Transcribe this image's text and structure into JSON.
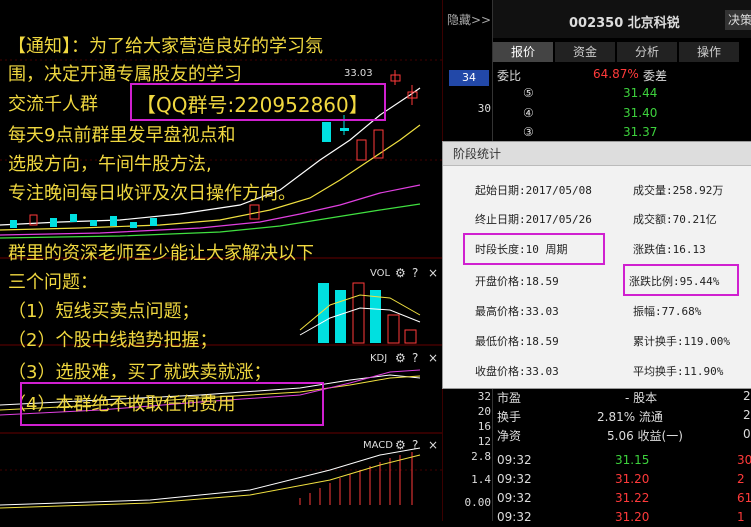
{
  "app": {
    "hide_label": "隐藏>>",
    "stock_title": "002350 北京科锐",
    "decision_button": "决策"
  },
  "tabs": [
    "报价",
    "资金",
    "分析",
    "操作"
  ],
  "quote": {
    "weibi_label": "委比",
    "weibi_value": "64.87%",
    "weicha_label": "委差",
    "sell_rows": [
      {
        "level": "⑤",
        "price": "31.44"
      },
      {
        "level": "④",
        "price": "31.40"
      },
      {
        "level": "③",
        "price": "31.37"
      }
    ]
  },
  "axis_labels": {
    "price_hl": "34",
    "price_30": "30",
    "p2_8": "2.8",
    "p1_4": "1.4",
    "p0_00": "0.00",
    "m32": "32",
    "m20": "20",
    "m16": "16",
    "m12": "12"
  },
  "chart_labels": {
    "date_tag": "33.03",
    "vol": "VOL",
    "kdj": "KDJ",
    "macd": "MACD",
    "gear": "⚙",
    "help": "?",
    "close": "×"
  },
  "notice": {
    "line1": "【通知】：为了给大家营造良好的学习氛",
    "line2": "围，决定开通专属股友的学习",
    "line3_pre": "交流千人群",
    "qq": "【QQ群号:220952860】",
    "line4": "每天9点前群里发早盘视点和",
    "line5": "选股方向，午间牛股方法,",
    "line6": "专注晚间每日收评及次日操作方向。",
    "line7": "群里的资深老师至少能让大家解决以下",
    "line8": "三个问题：",
    "line9": "（1）短线买卖点问题；",
    "line10": "（2）个股中线趋势把握；",
    "line11": "（3）选股难，买了就跌卖就涨；",
    "line12": "（4）本群绝不收取任何费用"
  },
  "stat_panel": {
    "title": "阶段统计",
    "start_date": "起始日期:2017/05/08",
    "end_date": "终止日期:2017/05/26",
    "duration": "时段长度:10 周期",
    "open_price": "开盘价格:18.59",
    "high_price": "最高价格:33.03",
    "low_price": "最低价格:18.59",
    "close_price": "收盘价格:33.03",
    "volume": "成交量:258.92万",
    "amount": "成交额:70.21亿",
    "change_value": "涨跌值:16.13",
    "change_pct": "涨跌比例:95.44%",
    "amplitude": "振幅:77.68%",
    "cum_turnover": "累计换手:119.00%",
    "avg_turnover": "平均换手:11.90%"
  },
  "info_rows": [
    {
      "label": "市盈",
      "value": "- 股本",
      "extra": "2"
    },
    {
      "label": "换手",
      "value": "2.81% 流通",
      "extra": "2"
    },
    {
      "label": "净资",
      "value": "5.06 收益(一)",
      "extra": "0"
    }
  ],
  "ticks": [
    {
      "time": "09:32",
      "price": "31.15",
      "vol": "30"
    },
    {
      "time": "09:32",
      "price": "31.20",
      "vol": "2"
    },
    {
      "time": "09:32",
      "price": "31.22",
      "vol": "61"
    },
    {
      "time": "09:32",
      "price": "31.20",
      "vol": "1"
    }
  ],
  "colors": {
    "up": "#ff3a3a",
    "down": "#00e0e0",
    "notice": "#f0d840",
    "highlight_box": "#d020d0",
    "green": "#3dd13d"
  }
}
